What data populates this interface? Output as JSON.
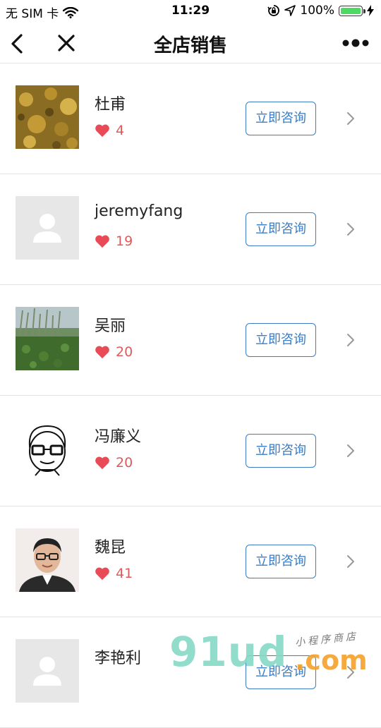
{
  "status_bar": {
    "carrier": "无 SIM 卡",
    "time": "11:29",
    "battery": "100%"
  },
  "nav": {
    "title": "全店销售"
  },
  "sellers": [
    {
      "name": "杜甫",
      "likes": "4",
      "button": "立即咨询",
      "avatar": "gold-texture-photo"
    },
    {
      "name": "jeremyfang",
      "likes": "19",
      "button": "立即咨询",
      "avatar": "default-placeholder"
    },
    {
      "name": "吴丽",
      "likes": "20",
      "button": "立即咨询",
      "avatar": "lotus-pond-photo"
    },
    {
      "name": "冯廉义",
      "likes": "20",
      "button": "立即咨询",
      "avatar": "cartoon-face"
    },
    {
      "name": "魏昆",
      "likes": "41",
      "button": "立即咨询",
      "avatar": "man-portrait-photo"
    },
    {
      "name": "李艳利",
      "likes": "",
      "button": "立即咨询",
      "avatar": "default-placeholder"
    }
  ],
  "watermark": {
    "main": "91ud",
    "suffix": ".com",
    "sub": "小程序商店"
  },
  "colors": {
    "accent_blue": "#3b7cc2",
    "heart_red": "#e84b55",
    "like_count": "#e05a5a",
    "divider": "#e2e2e2",
    "battery_green": "#4cd964"
  }
}
